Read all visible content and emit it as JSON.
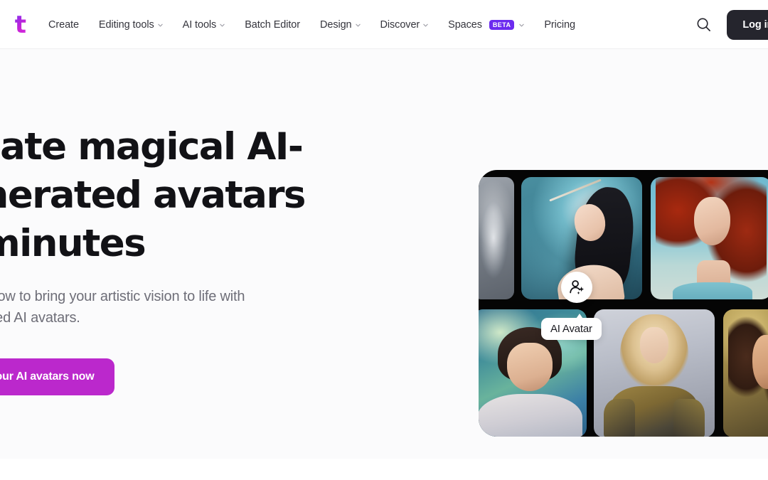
{
  "brand": {
    "mark": "t",
    "name": "picsart-logo"
  },
  "nav": {
    "items": [
      {
        "label": "Create",
        "has_caret": false
      },
      {
        "label": "Editing tools",
        "has_caret": true
      },
      {
        "label": "AI tools",
        "has_caret": true
      },
      {
        "label": "Batch Editor",
        "has_caret": false
      },
      {
        "label": "Design",
        "has_caret": true
      },
      {
        "label": "Discover",
        "has_caret": true
      },
      {
        "label": "Spaces",
        "has_caret": true,
        "badge": "BETA"
      },
      {
        "label": "Pricing",
        "has_caret": false
      }
    ],
    "search_icon": "search-icon",
    "login_label": "Log in o"
  },
  "hero": {
    "title": "Create magical AI-generated avatars in minutes",
    "subtitle": "Discover how to bring your artistic vision to life with personalized AI avatars.",
    "cta_label": "Create your AI avatars now"
  },
  "collage": {
    "fab_icon": "person-sparkle-icon",
    "tooltip_label": "AI Avatar",
    "tiles": [
      {
        "name": "avatar-tile-edge-left",
        "alt": "partially visible portrait"
      },
      {
        "name": "avatar-tile-warrior-woman",
        "alt": "dark-haired warrior woman with hairpin on teal background"
      },
      {
        "name": "avatar-tile-red-haired-woman",
        "alt": "red-haired woman on blue sky background"
      },
      {
        "name": "avatar-tile-young-man",
        "alt": "young man in hoodie on swirling green-blue sky"
      },
      {
        "name": "avatar-tile-blonde-knight",
        "alt": "blonde woman in golden armor"
      },
      {
        "name": "avatar-tile-curly-woman",
        "alt": "brown curly-haired woman on warm gold background"
      }
    ]
  },
  "colors": {
    "brand_magenta": "#bb28cc",
    "beta_violet": "#6c2bef",
    "login_dark": "#25252d",
    "hero_bg": "#fbfbfc",
    "text_primary": "#121216",
    "text_muted": "#6e6e78"
  }
}
